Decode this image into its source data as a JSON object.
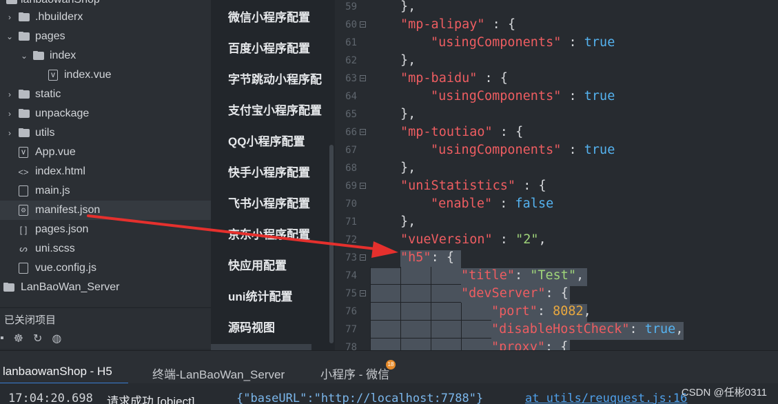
{
  "file_tree": {
    "items": [
      {
        "label": "lanbaowanShop",
        "icon": "folder-icon"
      },
      {
        "label": ".hbuilderx",
        "icon": "folder-icon"
      },
      {
        "label": "pages",
        "icon": "folder-open-icon"
      },
      {
        "label": "index",
        "icon": "folder-open-icon"
      },
      {
        "label": "index.vue",
        "icon": "vue-file-icon"
      },
      {
        "label": "static",
        "icon": "folder-icon"
      },
      {
        "label": "unpackage",
        "icon": "folder-icon"
      },
      {
        "label": "utils",
        "icon": "folder-icon"
      },
      {
        "label": "App.vue",
        "icon": "vue-file-icon"
      },
      {
        "label": "index.html",
        "icon": "html-file-icon"
      },
      {
        "label": "main.js",
        "icon": "js-file-icon"
      },
      {
        "label": "manifest.json",
        "icon": "settings-file-icon"
      },
      {
        "label": "pages.json",
        "icon": "json-file-icon"
      },
      {
        "label": "uni.scss",
        "icon": "scss-file-icon"
      },
      {
        "label": "vue.config.js",
        "icon": "js-file-icon"
      },
      {
        "label": "LanBaoWan_Server",
        "icon": "project-icon"
      }
    ],
    "closed_projects_label": "已关闭项目",
    "toolbar_icons": [
      "panel-icon",
      "bug-icon",
      "refresh-icon",
      "palette-icon"
    ]
  },
  "settings_nav": {
    "items": [
      "微信小程序配置",
      "百度小程序配置",
      "字节跳动小程序配",
      "支付宝小程序配置",
      "QQ小程序配置",
      "快手小程序配置",
      "飞书小程序配置",
      "京东小程序配置",
      "快应用配置",
      "uni统计配置",
      "源码视图"
    ]
  },
  "editor": {
    "lines": [
      {
        "n": "59",
        "t": [
          "},"
        ]
      },
      {
        "n": "60",
        "t": [
          "\"mp-alipay\"",
          " : {"
        ]
      },
      {
        "n": "61",
        "t": [
          "\"usingComponents\"",
          " : ",
          "true"
        ]
      },
      {
        "n": "62",
        "t": [
          "},"
        ]
      },
      {
        "n": "63",
        "t": [
          "\"mp-baidu\"",
          " : {"
        ]
      },
      {
        "n": "64",
        "t": [
          "\"usingComponents\"",
          " : ",
          "true"
        ]
      },
      {
        "n": "65",
        "t": [
          "},"
        ]
      },
      {
        "n": "66",
        "t": [
          "\"mp-toutiao\"",
          " : {"
        ]
      },
      {
        "n": "67",
        "t": [
          "\"usingComponents\"",
          " : ",
          "true"
        ]
      },
      {
        "n": "68",
        "t": [
          "},"
        ]
      },
      {
        "n": "69",
        "t": [
          "\"uniStatistics\"",
          " : {"
        ]
      },
      {
        "n": "70",
        "t": [
          "\"enable\"",
          " : ",
          "false"
        ]
      },
      {
        "n": "71",
        "t": [
          "},"
        ]
      },
      {
        "n": "72",
        "t": [
          "\"vueVersion\"",
          " : ",
          "\"2\"",
          ","
        ]
      },
      {
        "n": "73",
        "t": [
          "\"h5\"",
          ": {"
        ]
      },
      {
        "n": "74",
        "t": [
          "\"title\"",
          ": ",
          "\"Test\"",
          ","
        ]
      },
      {
        "n": "75",
        "t": [
          "\"devServer\"",
          ": {"
        ]
      },
      {
        "n": "76",
        "t": [
          "\"port\"",
          ": ",
          "8082",
          ","
        ]
      },
      {
        "n": "77",
        "t": [
          "\"disableHostCheck\"",
          ": ",
          "true",
          ","
        ]
      },
      {
        "n": "78",
        "t": [
          "\"proxy\"",
          ": {"
        ]
      }
    ]
  },
  "bottom_tabs": {
    "tabs": [
      "lanbaowanShop - H5",
      "终端-LanBaoWan_Server",
      "小程序 - 微信"
    ],
    "badge": "18"
  },
  "console": {
    "time": "17:04:20.698",
    "message": "请求成功 [object]",
    "json": "{\"baseURL\":\"http://localhost:7788\"}",
    "source": "at utils/reuquest.js:16"
  },
  "watermark": "CSDN @任彬0311",
  "colors": {
    "annotation_arrow": "#e5302d",
    "key": "#ee5d61",
    "string": "#9fd47a",
    "boolean": "#55b3f0",
    "number": "#e9a83f"
  }
}
